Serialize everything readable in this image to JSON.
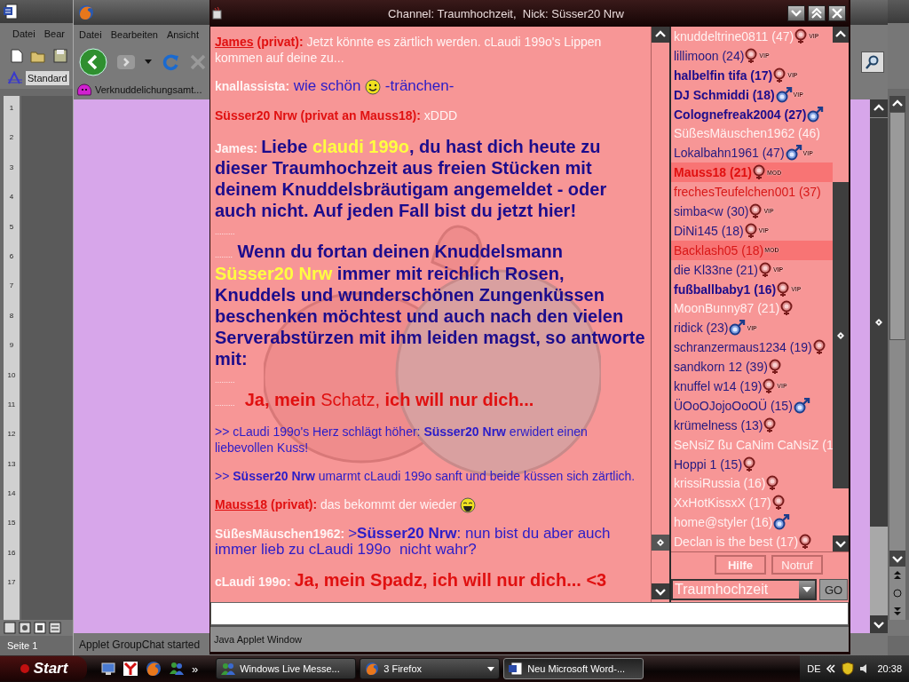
{
  "word_window": {
    "menu": [
      "Datei",
      "Bear"
    ],
    "style_box": "Standard",
    "ruler_numbers": [
      "1",
      "2",
      "3",
      "4",
      "5",
      "6",
      "7",
      "8",
      "9",
      "10",
      "11",
      "12",
      "13",
      "14",
      "15",
      "16",
      "17"
    ],
    "status": "Seite 1"
  },
  "firefox_window": {
    "menu": [
      "Datei",
      "Bearbeiten",
      "Ansicht"
    ],
    "bookmark": "Verknuddelichungsamt...",
    "status": "Applet GroupChat started"
  },
  "chat_window": {
    "title": "Channel: Traumhochzeit,  Nick: Süsser20 Nrw",
    "messages": [
      {
        "kind": "message",
        "parts": [
          {
            "kind": "link",
            "text": "James"
          },
          {
            "kind": "private",
            "text": " (privat):"
          },
          {
            "kind": "plain",
            "text": " Jetzt könnte es zärtlich werden. cLaudi 199o's Lippen kommen auf deine zu..."
          }
        ]
      },
      {
        "kind": "message",
        "parts": [
          {
            "kind": "nick",
            "text": "knallassista:"
          },
          {
            "kind": "chat",
            "text": " wie schön "
          },
          {
            "kind": "smiley"
          },
          {
            "kind": "chat",
            "text": " -tränchen-"
          }
        ]
      },
      {
        "kind": "message",
        "parts": [
          {
            "kind": "private",
            "text": "Süsser20 Nrw (privat an Mauss18):"
          },
          {
            "kind": "plain",
            "text": " xDDD"
          }
        ]
      },
      {
        "kind": "message",
        "parts": [
          {
            "kind": "nick",
            "text": "James: "
          },
          {
            "kind": "announce",
            "text": "Liebe "
          },
          {
            "kind": "name",
            "text": "claudi 199o"
          },
          {
            "kind": "announce",
            "text": ", du hast dich heute zu dieser Traumhochzeit aus freien Stücken mit deinem Knuddelsbräutigam angemeldet - oder auch nicht. Auf jeden Fall bist du jetzt hier!"
          }
        ]
      },
      {
        "kind": "filler",
        "parts": [
          {
            "kind": "dots",
            "text": "........."
          }
        ]
      },
      {
        "kind": "message",
        "parts": [
          {
            "kind": "dots",
            "text": "........"
          },
          {
            "kind": "announce",
            "text": " Wenn du fortan deinen Knuddelsmann "
          },
          {
            "kind": "name",
            "text": "Süsser20 Nrw"
          },
          {
            "kind": "announce",
            "text": " immer mit reichlich Rosen, Knuddels und wunderschönen Zungenküssen beschenken möchtest und auch nach den vielen Serverabstürzen mit ihm leiden magst, so antworte mit:"
          }
        ]
      },
      {
        "kind": "filler",
        "parts": [
          {
            "kind": "dots",
            "text": "........."
          }
        ]
      },
      {
        "kind": "message",
        "parts": [
          {
            "kind": "dots",
            "text": "........."
          },
          {
            "kind": "vow",
            "text": "  Ja, mein "
          },
          {
            "kind": "soft",
            "text": "Schatz, "
          },
          {
            "kind": "vow",
            "text": "ich will nur dich..."
          }
        ]
      },
      {
        "kind": "message",
        "parts": [
          {
            "kind": "action",
            "text": ">> cLaudi 199o's Herz schlägt höher: "
          },
          {
            "kind": "actor",
            "text": "Süsser20 Nrw"
          },
          {
            "kind": "action",
            "text": " erwidert einen liebevollen Kuss!"
          }
        ]
      },
      {
        "kind": "message",
        "parts": [
          {
            "kind": "action",
            "text": ">> "
          },
          {
            "kind": "actor",
            "text": "Süsser20 Nrw"
          },
          {
            "kind": "action",
            "text": " umarmt cLaudi 199o sanft und beide küssen sich zärtlich."
          }
        ]
      },
      {
        "kind": "message",
        "parts": [
          {
            "kind": "link",
            "text": "Mauss18"
          },
          {
            "kind": "private",
            "text": " (privat):"
          },
          {
            "kind": "plain",
            "text": " das bekommt der wieder "
          },
          {
            "kind": "laughing"
          }
        ]
      },
      {
        "kind": "message",
        "parts": [
          {
            "kind": "nick",
            "text": "SüßesMäuschen1962: "
          },
          {
            "kind": "chat",
            "text": ">"
          },
          {
            "kind": "mention",
            "text": "Süsser20 Nrw"
          },
          {
            "kind": "chat",
            "text": ": nun bist du aber auch immer lieb zu cLaudi 199o  nicht wahr?"
          }
        ]
      },
      {
        "kind": "message",
        "parts": [
          {
            "kind": "nick",
            "text": "cLaudi 199o: "
          },
          {
            "kind": "vow",
            "text": "Ja, mein Spadz, ich will nur dich... <3"
          }
        ]
      }
    ],
    "users": [
      {
        "name": "knuddeltrine0811 (47)",
        "color": "#fff0f0",
        "bold": false,
        "highlighted": false,
        "kind": "female",
        "badge": "VIP"
      },
      {
        "name": "lillimoon (24)",
        "color": "#241a80",
        "bold": false,
        "highlighted": false,
        "kind": "female",
        "badge": "VIP"
      },
      {
        "name": "halbelfin tifa (17)",
        "color": "#1c0c8c",
        "bold": true,
        "highlighted": false,
        "kind": "female",
        "badge": "VIP"
      },
      {
        "name": "DJ Schmiddi (18)",
        "color": "#1c0c8c",
        "bold": true,
        "highlighted": false,
        "kind": "male",
        "badge": "VIP"
      },
      {
        "name": "Colognefreak2004 (27)",
        "color": "#1c0c8c",
        "bold": true,
        "highlighted": false,
        "kind": "male"
      },
      {
        "name": "SüßesMäuschen1962 (46)",
        "color": "#fff0f0",
        "bold": false,
        "highlighted": false,
        "kind": "plain"
      },
      {
        "name": "Lokalbahn1961 (47)",
        "color": "#241a80",
        "bold": false,
        "highlighted": false,
        "kind": "male",
        "badge": "VIP"
      },
      {
        "name": "Mauss18 (21)",
        "color": "#e01010",
        "bold": true,
        "highlighted": true,
        "kind": "female",
        "badge": "MOD"
      },
      {
        "name": "frechesTeufelchen001 (37)",
        "color": "#d81818",
        "bold": false,
        "highlighted": false,
        "kind": "plain"
      },
      {
        "name": "simba<w (30)",
        "color": "#241a80",
        "bold": false,
        "highlighted": false,
        "kind": "female",
        "badge": "VIP"
      },
      {
        "name": "DiNi145 (18)",
        "color": "#241a80",
        "bold": false,
        "highlighted": false,
        "kind": "female",
        "badge": "VIP"
      },
      {
        "name": "Backlash05 (18)",
        "color": "#d81818",
        "bold": false,
        "highlighted": true,
        "kind": "plain",
        "badge": "MOD"
      },
      {
        "name": "die Kl33ne (21)",
        "color": "#241a80",
        "bold": false,
        "highlighted": false,
        "kind": "female",
        "badge": "VIP"
      },
      {
        "name": "fußballbaby1 (16)",
        "color": "#1c0c8c",
        "bold": true,
        "highlighted": false,
        "kind": "female",
        "badge": "VIP"
      },
      {
        "name": "MoonBunny87 (21)",
        "color": "#fff0f0",
        "bold": false,
        "highlighted": false,
        "kind": "female"
      },
      {
        "name": "ridick (23)",
        "color": "#241a80",
        "bold": false,
        "highlighted": false,
        "kind": "male",
        "badge": "VIP"
      },
      {
        "name": "schranzermaus1234 (19)",
        "color": "#241a80",
        "bold": false,
        "highlighted": false,
        "kind": "female"
      },
      {
        "name": "sandkorn 12 (39)",
        "color": "#241a80",
        "bold": false,
        "highlighted": false,
        "kind": "female"
      },
      {
        "name": "knuffel w14 (19)",
        "color": "#241a80",
        "bold": false,
        "highlighted": false,
        "kind": "female",
        "badge": "VIP"
      },
      {
        "name": "ÜOoOJojoOoOÜ (15)",
        "color": "#241a80",
        "bold": false,
        "highlighted": false,
        "kind": "male"
      },
      {
        "name": "krümelness (13)",
        "color": "#241a80",
        "bold": false,
        "highlighted": false,
        "kind": "female"
      },
      {
        "name": "SeNsiZ ßu CaNim CaNsiZ (1",
        "color": "#fff0f0",
        "bold": false,
        "highlighted": false,
        "kind": "plain"
      },
      {
        "name": "Hoppi 1 (15)",
        "color": "#241a80",
        "bold": false,
        "highlighted": false,
        "kind": "female"
      },
      {
        "name": "krissiRussia (16)",
        "color": "#fff0f0",
        "bold": false,
        "highlighted": false,
        "kind": "female"
      },
      {
        "name": "XxHotKissxX (17)",
        "color": "#fff0f0",
        "bold": false,
        "highlighted": false,
        "kind": "female"
      },
      {
        "name": "home@styler (16)",
        "color": "#fff0f0",
        "bold": false,
        "highlighted": false,
        "kind": "male"
      },
      {
        "name": "Declan is the best (17)",
        "color": "#fff0f0",
        "bold": false,
        "highlighted": false,
        "kind": "female"
      }
    ],
    "buttons": [
      {
        "label": "Hilfe",
        "bold": true
      },
      {
        "label": "Notruf",
        "bold": false
      }
    ],
    "channel_select": "Traumhochzeit",
    "go_button": "GO",
    "status": "Java Applet Window"
  },
  "taskbar": {
    "start": "Start",
    "more": "»",
    "tasks": [
      {
        "label": "Windows Live Messe...",
        "selected": false
      },
      {
        "label": "3 Firefox",
        "selected": false
      },
      {
        "label": "Neu Microsoft Word-...",
        "selected": true
      }
    ],
    "language": "DE",
    "clock": "20:38"
  }
}
